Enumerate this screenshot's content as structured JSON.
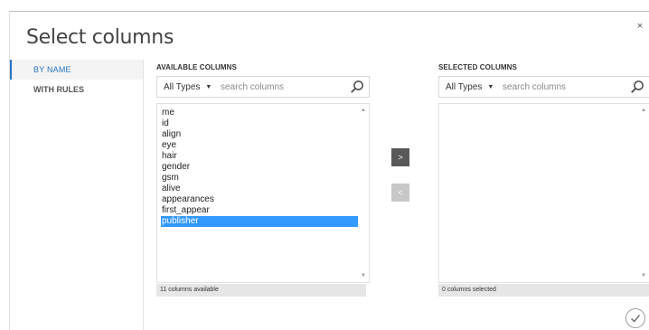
{
  "dialog": {
    "title": "Select columns",
    "close_label": "×"
  },
  "nav": {
    "items": [
      {
        "label": "BY NAME",
        "active": true
      },
      {
        "label": "WITH RULES",
        "active": false
      }
    ]
  },
  "available": {
    "header": "AVAILABLE COLUMNS",
    "type_filter": "All Types",
    "search_placeholder": "search columns",
    "columns": [
      "me",
      "id",
      "align",
      "eye",
      "hair",
      "gender",
      "gsm",
      "alive",
      "appearances",
      "first_appear",
      "publisher"
    ],
    "selected_item": "publisher",
    "status": "11 columns available"
  },
  "selected": {
    "header": "SELECTED COLUMNS",
    "type_filter": "All Types",
    "search_placeholder": "search columns",
    "columns": [],
    "status": "0 columns selected"
  },
  "actions": {
    "add_label": ">",
    "remove_label": "<"
  },
  "icons": {
    "close": "close-icon",
    "search": "search-icon",
    "ok": "checkmark-icon",
    "dropdown": "triangle-down-icon",
    "scroll_up": "scroll-up-arrow-icon",
    "scroll_down": "scroll-down-arrow-icon"
  },
  "colors": {
    "accent": "#2a75c4",
    "selection": "#3399ff",
    "add_button": "#595959",
    "remove_button": "#c8c8c8",
    "status_bar": "#e6e6e6"
  }
}
